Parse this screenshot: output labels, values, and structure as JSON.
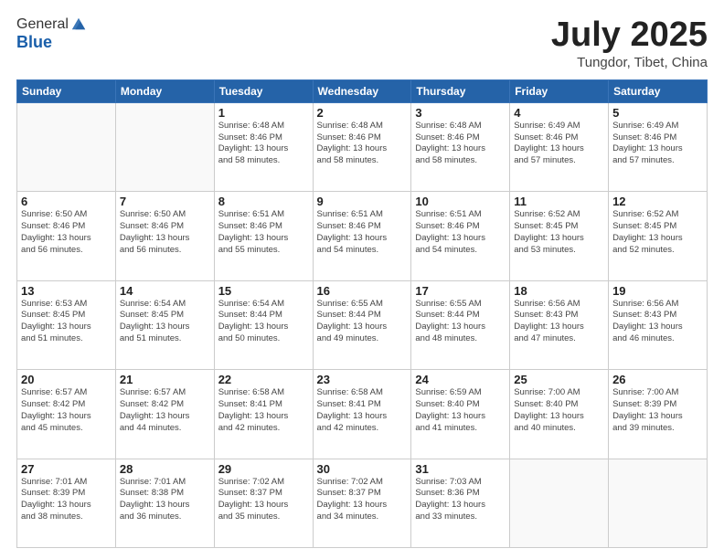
{
  "header": {
    "logo_general": "General",
    "logo_blue": "Blue",
    "month": "July 2025",
    "location": "Tungdor, Tibet, China"
  },
  "days_of_week": [
    "Sunday",
    "Monday",
    "Tuesday",
    "Wednesday",
    "Thursday",
    "Friday",
    "Saturday"
  ],
  "weeks": [
    [
      {
        "day": "",
        "info": ""
      },
      {
        "day": "",
        "info": ""
      },
      {
        "day": "1",
        "info": "Sunrise: 6:48 AM\nSunset: 8:46 PM\nDaylight: 13 hours\nand 58 minutes."
      },
      {
        "day": "2",
        "info": "Sunrise: 6:48 AM\nSunset: 8:46 PM\nDaylight: 13 hours\nand 58 minutes."
      },
      {
        "day": "3",
        "info": "Sunrise: 6:48 AM\nSunset: 8:46 PM\nDaylight: 13 hours\nand 58 minutes."
      },
      {
        "day": "4",
        "info": "Sunrise: 6:49 AM\nSunset: 8:46 PM\nDaylight: 13 hours\nand 57 minutes."
      },
      {
        "day": "5",
        "info": "Sunrise: 6:49 AM\nSunset: 8:46 PM\nDaylight: 13 hours\nand 57 minutes."
      }
    ],
    [
      {
        "day": "6",
        "info": "Sunrise: 6:50 AM\nSunset: 8:46 PM\nDaylight: 13 hours\nand 56 minutes."
      },
      {
        "day": "7",
        "info": "Sunrise: 6:50 AM\nSunset: 8:46 PM\nDaylight: 13 hours\nand 56 minutes."
      },
      {
        "day": "8",
        "info": "Sunrise: 6:51 AM\nSunset: 8:46 PM\nDaylight: 13 hours\nand 55 minutes."
      },
      {
        "day": "9",
        "info": "Sunrise: 6:51 AM\nSunset: 8:46 PM\nDaylight: 13 hours\nand 54 minutes."
      },
      {
        "day": "10",
        "info": "Sunrise: 6:51 AM\nSunset: 8:46 PM\nDaylight: 13 hours\nand 54 minutes."
      },
      {
        "day": "11",
        "info": "Sunrise: 6:52 AM\nSunset: 8:45 PM\nDaylight: 13 hours\nand 53 minutes."
      },
      {
        "day": "12",
        "info": "Sunrise: 6:52 AM\nSunset: 8:45 PM\nDaylight: 13 hours\nand 52 minutes."
      }
    ],
    [
      {
        "day": "13",
        "info": "Sunrise: 6:53 AM\nSunset: 8:45 PM\nDaylight: 13 hours\nand 51 minutes."
      },
      {
        "day": "14",
        "info": "Sunrise: 6:54 AM\nSunset: 8:45 PM\nDaylight: 13 hours\nand 51 minutes."
      },
      {
        "day": "15",
        "info": "Sunrise: 6:54 AM\nSunset: 8:44 PM\nDaylight: 13 hours\nand 50 minutes."
      },
      {
        "day": "16",
        "info": "Sunrise: 6:55 AM\nSunset: 8:44 PM\nDaylight: 13 hours\nand 49 minutes."
      },
      {
        "day": "17",
        "info": "Sunrise: 6:55 AM\nSunset: 8:44 PM\nDaylight: 13 hours\nand 48 minutes."
      },
      {
        "day": "18",
        "info": "Sunrise: 6:56 AM\nSunset: 8:43 PM\nDaylight: 13 hours\nand 47 minutes."
      },
      {
        "day": "19",
        "info": "Sunrise: 6:56 AM\nSunset: 8:43 PM\nDaylight: 13 hours\nand 46 minutes."
      }
    ],
    [
      {
        "day": "20",
        "info": "Sunrise: 6:57 AM\nSunset: 8:42 PM\nDaylight: 13 hours\nand 45 minutes."
      },
      {
        "day": "21",
        "info": "Sunrise: 6:57 AM\nSunset: 8:42 PM\nDaylight: 13 hours\nand 44 minutes."
      },
      {
        "day": "22",
        "info": "Sunrise: 6:58 AM\nSunset: 8:41 PM\nDaylight: 13 hours\nand 42 minutes."
      },
      {
        "day": "23",
        "info": "Sunrise: 6:58 AM\nSunset: 8:41 PM\nDaylight: 13 hours\nand 42 minutes."
      },
      {
        "day": "24",
        "info": "Sunrise: 6:59 AM\nSunset: 8:40 PM\nDaylight: 13 hours\nand 41 minutes."
      },
      {
        "day": "25",
        "info": "Sunrise: 7:00 AM\nSunset: 8:40 PM\nDaylight: 13 hours\nand 40 minutes."
      },
      {
        "day": "26",
        "info": "Sunrise: 7:00 AM\nSunset: 8:39 PM\nDaylight: 13 hours\nand 39 minutes."
      }
    ],
    [
      {
        "day": "27",
        "info": "Sunrise: 7:01 AM\nSunset: 8:39 PM\nDaylight: 13 hours\nand 38 minutes."
      },
      {
        "day": "28",
        "info": "Sunrise: 7:01 AM\nSunset: 8:38 PM\nDaylight: 13 hours\nand 36 minutes."
      },
      {
        "day": "29",
        "info": "Sunrise: 7:02 AM\nSunset: 8:37 PM\nDaylight: 13 hours\nand 35 minutes."
      },
      {
        "day": "30",
        "info": "Sunrise: 7:02 AM\nSunset: 8:37 PM\nDaylight: 13 hours\nand 34 minutes."
      },
      {
        "day": "31",
        "info": "Sunrise: 7:03 AM\nSunset: 8:36 PM\nDaylight: 13 hours\nand 33 minutes."
      },
      {
        "day": "",
        "info": ""
      },
      {
        "day": "",
        "info": ""
      }
    ]
  ]
}
